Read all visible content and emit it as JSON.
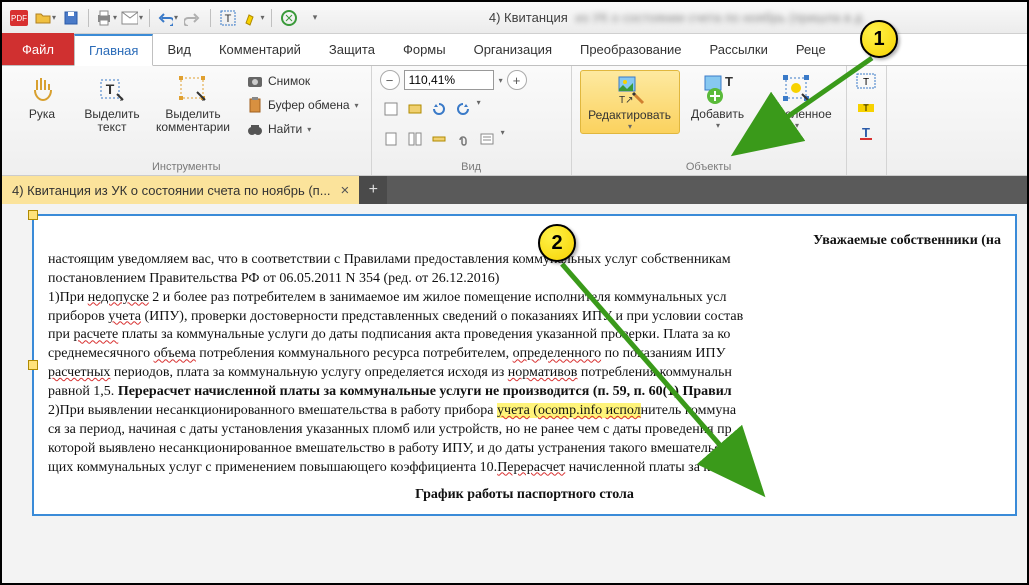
{
  "qat_title": "4) Квитанция",
  "qat_title_blur": "из УК о состоянии счета по ноябрь (пришла в д",
  "tabs": {
    "file": "Файл",
    "home": "Главная",
    "view": "Вид",
    "comment": "Комментарий",
    "protect": "Защита",
    "forms": "Формы",
    "organize": "Организация",
    "convert": "Преобразование",
    "mailings": "Рассылки",
    "recipes": "Реце"
  },
  "groups": {
    "tools_label": "Инструменты",
    "view_label": "Вид",
    "objects_label": "Объекты"
  },
  "tools": {
    "hand": "Рука",
    "select_text": "Выделить текст",
    "select_comments": "Выделить комментарии",
    "snapshot": "Снимок",
    "clipboard": "Буфер обмена",
    "find": "Найти"
  },
  "view": {
    "zoom_value": "110,41%"
  },
  "objects": {
    "edit": "Редактировать",
    "add": "Добавить",
    "selected": "Выделенное"
  },
  "doc_tab": {
    "title": "4) Квитанция из УК о состоянии счета по ноябрь (п..."
  },
  "doc": {
    "heading1": "Уважаемые собственники (на",
    "p1a": "настоящим уведомляем вас, что в соответствии с Правилами предоставления коммунальных услуг собственникам",
    "p1b": "постановлением Правительства РФ от 06.05.2011 N 354 (ред. от 26.12.2016)",
    "l1a": "1)При ",
    "l1_nedopuske": "недопуске",
    "l1b": " 2 и более раз потребителем в занимаемое им жилое помещение исполнителя коммунальных усл",
    "l2a": "приборов ",
    "l2_ucheta": "учета",
    "l2b": " (ИПУ), проверки достоверности представленных сведений о показаниях ИПУ и при условии состав",
    "l3a": "при ",
    "l3_raschete": "расчете",
    "l3b": " платы за коммунальные услуги до даты подписания акта проведения указанной проверки. Плата за ко",
    "l4a": "среднемесячного ",
    "l4_obema": "объема",
    "l4b": " потребления коммунального ресурса потребителем, ",
    "l4_opred": "определенного",
    "l4c": " по показаниям ИПУ ",
    "l5_rasch": "расчетных",
    "l5a": " периодов, плата за коммунальную услугу определяется исходя из ",
    "l5_norm": "нормативов",
    "l5b": " потребления коммунальн",
    "l6a": "равной 1,5. ",
    "l6_bold": "Перерасчет начисленной платы за коммунальные услуги не производится (п. 59, п. 60(1) Правил",
    "l7a": "2)При выявлении несанкционированного вмешательства в работу прибора ",
    "l7_h1": "учета",
    "l7_sp": " (",
    "l7_h2": "ocomp.info",
    "l7_sp2": " ",
    "l7_h3": "испол",
    "l7b": "нитель коммуна",
    "l8": "ся за период, начиная с даты установления указанных пломб или устройств, но не ранее чем с даты проведения пр",
    "l9": "которой выявлено несанкционированное вмешательство в работу ИПУ, и до даты устранения такого вмешательств",
    "l10a": "щих коммунальных услуг с применением повышающего коэффициента 10.",
    "l10_pererasch": "Перерасчет",
    "l10b": " начисленной платы за комм",
    "heading2": "График работы паспортного стола"
  },
  "callouts": {
    "one": "1",
    "two": "2"
  }
}
